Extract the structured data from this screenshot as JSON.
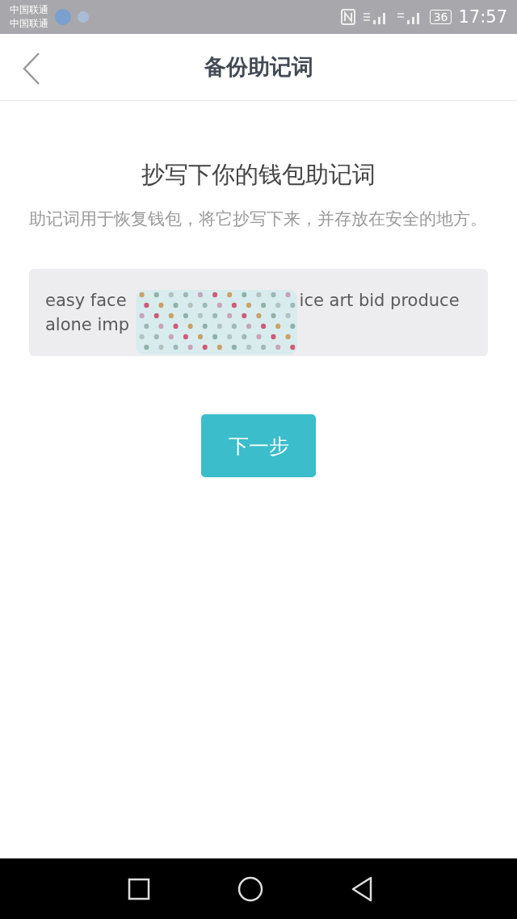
{
  "status_bar": {
    "carriers": [
      "中国联通",
      "中国联通"
    ],
    "battery": "36",
    "time": "17:57"
  },
  "header": {
    "title": "备份助记词"
  },
  "heading": "抄写下你的钱包助记词",
  "description": "助记词用于恢复钱包，将它抄写下来，并存放在安全的地方。",
  "mnemonic": {
    "lines": [
      {
        "visible_start": "easy face",
        "visible_end": "ice art bid produce"
      },
      {
        "visible_start": "alone imp"
      }
    ],
    "redacted": true
  },
  "next_button": {
    "label": "下一步"
  }
}
